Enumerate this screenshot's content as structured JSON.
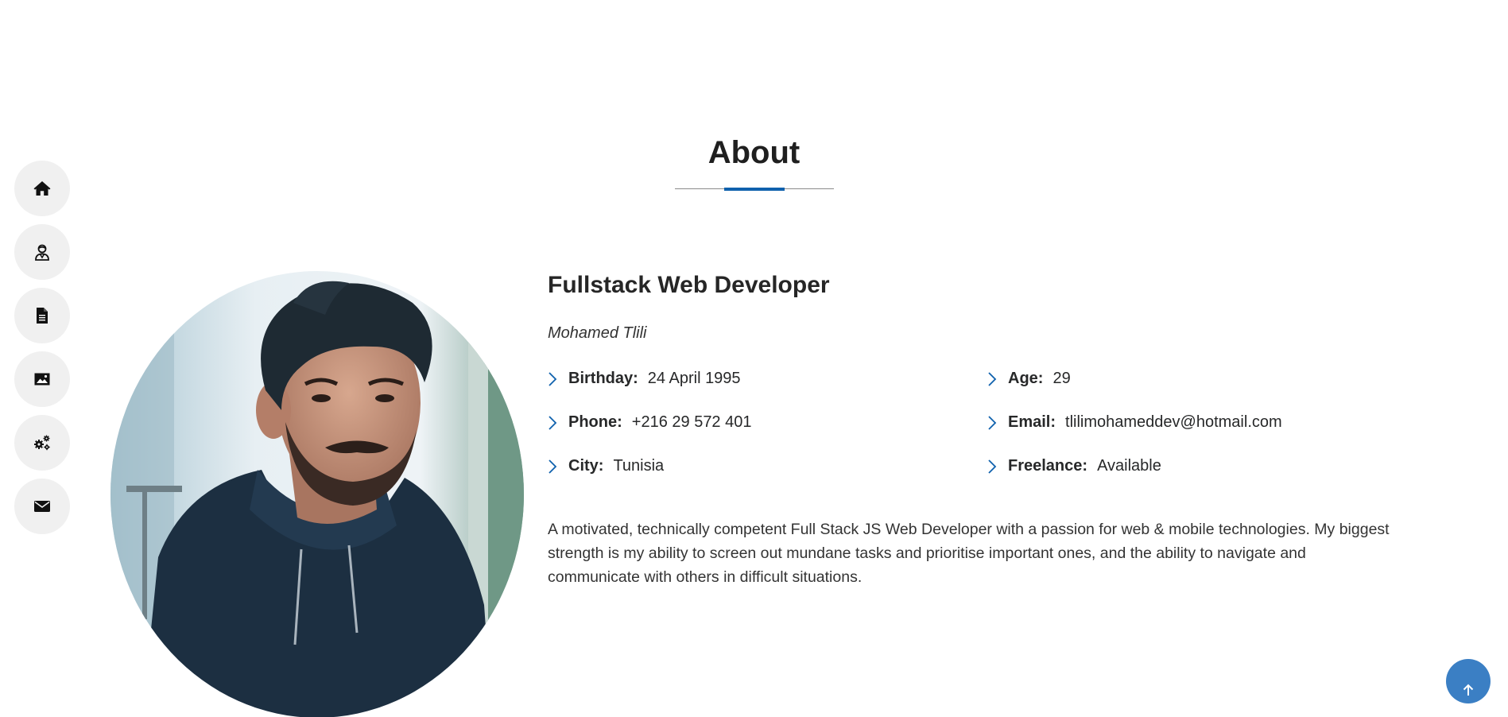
{
  "nav": {
    "items": [
      {
        "id": "home",
        "icon": "home-icon"
      },
      {
        "id": "about",
        "icon": "person-icon"
      },
      {
        "id": "resume",
        "icon": "document-icon"
      },
      {
        "id": "portfolio",
        "icon": "image-icon"
      },
      {
        "id": "services",
        "icon": "gears-icon"
      },
      {
        "id": "contact",
        "icon": "envelope-icon"
      }
    ]
  },
  "section": {
    "title": "About",
    "accent_color": "#0f61ad"
  },
  "about": {
    "role": "Fullstack Web Developer",
    "name": "Mohamed Tlili",
    "details": {
      "birthday": {
        "label": "Birthday:",
        "value": "24 April 1995"
      },
      "age": {
        "label": "Age:",
        "value": "29"
      },
      "phone": {
        "label": "Phone:",
        "value": "+216 29 572 401"
      },
      "email": {
        "label": "Email:",
        "value": "tlilimohameddev@hotmail.com"
      },
      "city": {
        "label": "City:",
        "value": "Tunisia"
      },
      "freelance": {
        "label": "Freelance:",
        "value": "Available"
      }
    },
    "bio": "A motivated, technically competent Full Stack JS Web Developer with a passion for web & mobile technologies. My biggest strength is my ability to screen out mundane tasks and prioritise important ones, and the ability to navigate and communicate with others in difficult situations."
  },
  "back_to_top": {
    "icon": "arrow-up-icon",
    "color": "#3b7fc4"
  }
}
